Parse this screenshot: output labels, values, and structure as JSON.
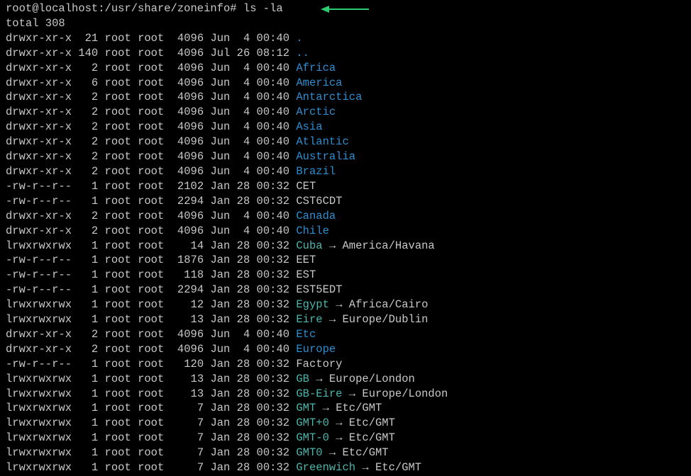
{
  "prompt": {
    "user_host": "root@localhost",
    "separator": ":",
    "cwd": "/usr/share/zoneinfo",
    "marker": "#",
    "command": "ls -la"
  },
  "total_line": "total 308",
  "columns_pad": {
    "links": 3,
    "size": 5
  },
  "entries": [
    {
      "perms": "drwxr-xr-x",
      "links": "21",
      "owner": "root",
      "group": "root",
      "size": "4096",
      "date": "Jun  4 00:40",
      "name": ".",
      "type": "dir"
    },
    {
      "perms": "drwxr-xr-x",
      "links": "140",
      "owner": "root",
      "group": "root",
      "size": "4096",
      "date": "Jul 26 08:12",
      "name": "..",
      "type": "dir"
    },
    {
      "perms": "drwxr-xr-x",
      "links": "2",
      "owner": "root",
      "group": "root",
      "size": "4096",
      "date": "Jun  4 00:40",
      "name": "Africa",
      "type": "dir"
    },
    {
      "perms": "drwxr-xr-x",
      "links": "6",
      "owner": "root",
      "group": "root",
      "size": "4096",
      "date": "Jun  4 00:40",
      "name": "America",
      "type": "dir"
    },
    {
      "perms": "drwxr-xr-x",
      "links": "2",
      "owner": "root",
      "group": "root",
      "size": "4096",
      "date": "Jun  4 00:40",
      "name": "Antarctica",
      "type": "dir"
    },
    {
      "perms": "drwxr-xr-x",
      "links": "2",
      "owner": "root",
      "group": "root",
      "size": "4096",
      "date": "Jun  4 00:40",
      "name": "Arctic",
      "type": "dir"
    },
    {
      "perms": "drwxr-xr-x",
      "links": "2",
      "owner": "root",
      "group": "root",
      "size": "4096",
      "date": "Jun  4 00:40",
      "name": "Asia",
      "type": "dir"
    },
    {
      "perms": "drwxr-xr-x",
      "links": "2",
      "owner": "root",
      "group": "root",
      "size": "4096",
      "date": "Jun  4 00:40",
      "name": "Atlantic",
      "type": "dir"
    },
    {
      "perms": "drwxr-xr-x",
      "links": "2",
      "owner": "root",
      "group": "root",
      "size": "4096",
      "date": "Jun  4 00:40",
      "name": "Australia",
      "type": "dir"
    },
    {
      "perms": "drwxr-xr-x",
      "links": "2",
      "owner": "root",
      "group": "root",
      "size": "4096",
      "date": "Jun  4 00:40",
      "name": "Brazil",
      "type": "dir"
    },
    {
      "perms": "-rw-r--r--",
      "links": "1",
      "owner": "root",
      "group": "root",
      "size": "2102",
      "date": "Jan 28 00:32",
      "name": "CET",
      "type": "reg"
    },
    {
      "perms": "-rw-r--r--",
      "links": "1",
      "owner": "root",
      "group": "root",
      "size": "2294",
      "date": "Jan 28 00:32",
      "name": "CST6CDT",
      "type": "reg"
    },
    {
      "perms": "drwxr-xr-x",
      "links": "2",
      "owner": "root",
      "group": "root",
      "size": "4096",
      "date": "Jun  4 00:40",
      "name": "Canada",
      "type": "dir"
    },
    {
      "perms": "drwxr-xr-x",
      "links": "2",
      "owner": "root",
      "group": "root",
      "size": "4096",
      "date": "Jun  4 00:40",
      "name": "Chile",
      "type": "dir"
    },
    {
      "perms": "lrwxrwxrwx",
      "links": "1",
      "owner": "root",
      "group": "root",
      "size": "14",
      "date": "Jan 28 00:32",
      "name": "Cuba",
      "type": "link",
      "target": "America/Havana"
    },
    {
      "perms": "-rw-r--r--",
      "links": "1",
      "owner": "root",
      "group": "root",
      "size": "1876",
      "date": "Jan 28 00:32",
      "name": "EET",
      "type": "reg"
    },
    {
      "perms": "-rw-r--r--",
      "links": "1",
      "owner": "root",
      "group": "root",
      "size": "118",
      "date": "Jan 28 00:32",
      "name": "EST",
      "type": "reg"
    },
    {
      "perms": "-rw-r--r--",
      "links": "1",
      "owner": "root",
      "group": "root",
      "size": "2294",
      "date": "Jan 28 00:32",
      "name": "EST5EDT",
      "type": "reg"
    },
    {
      "perms": "lrwxrwxrwx",
      "links": "1",
      "owner": "root",
      "group": "root",
      "size": "12",
      "date": "Jan 28 00:32",
      "name": "Egypt",
      "type": "link",
      "target": "Africa/Cairo"
    },
    {
      "perms": "lrwxrwxrwx",
      "links": "1",
      "owner": "root",
      "group": "root",
      "size": "13",
      "date": "Jan 28 00:32",
      "name": "Eire",
      "type": "link",
      "target": "Europe/Dublin"
    },
    {
      "perms": "drwxr-xr-x",
      "links": "2",
      "owner": "root",
      "group": "root",
      "size": "4096",
      "date": "Jun  4 00:40",
      "name": "Etc",
      "type": "dir"
    },
    {
      "perms": "drwxr-xr-x",
      "links": "2",
      "owner": "root",
      "group": "root",
      "size": "4096",
      "date": "Jun  4 00:40",
      "name": "Europe",
      "type": "dir"
    },
    {
      "perms": "-rw-r--r--",
      "links": "1",
      "owner": "root",
      "group": "root",
      "size": "120",
      "date": "Jan 28 00:32",
      "name": "Factory",
      "type": "reg"
    },
    {
      "perms": "lrwxrwxrwx",
      "links": "1",
      "owner": "root",
      "group": "root",
      "size": "13",
      "date": "Jan 28 00:32",
      "name": "GB",
      "type": "link",
      "target": "Europe/London"
    },
    {
      "perms": "lrwxrwxrwx",
      "links": "1",
      "owner": "root",
      "group": "root",
      "size": "13",
      "date": "Jan 28 00:32",
      "name": "GB-Eire",
      "type": "link",
      "target": "Europe/London"
    },
    {
      "perms": "lrwxrwxrwx",
      "links": "1",
      "owner": "root",
      "group": "root",
      "size": "7",
      "date": "Jan 28 00:32",
      "name": "GMT",
      "type": "link",
      "target": "Etc/GMT"
    },
    {
      "perms": "lrwxrwxrwx",
      "links": "1",
      "owner": "root",
      "group": "root",
      "size": "7",
      "date": "Jan 28 00:32",
      "name": "GMT+0",
      "type": "link",
      "target": "Etc/GMT"
    },
    {
      "perms": "lrwxrwxrwx",
      "links": "1",
      "owner": "root",
      "group": "root",
      "size": "7",
      "date": "Jan 28 00:32",
      "name": "GMT-0",
      "type": "link",
      "target": "Etc/GMT"
    },
    {
      "perms": "lrwxrwxrwx",
      "links": "1",
      "owner": "root",
      "group": "root",
      "size": "7",
      "date": "Jan 28 00:32",
      "name": "GMT0",
      "type": "link",
      "target": "Etc/GMT"
    },
    {
      "perms": "lrwxrwxrwx",
      "links": "1",
      "owner": "root",
      "group": "root",
      "size": "7",
      "date": "Jan 28 00:32",
      "name": "Greenwich",
      "type": "link",
      "target": "Etc/GMT"
    }
  ]
}
